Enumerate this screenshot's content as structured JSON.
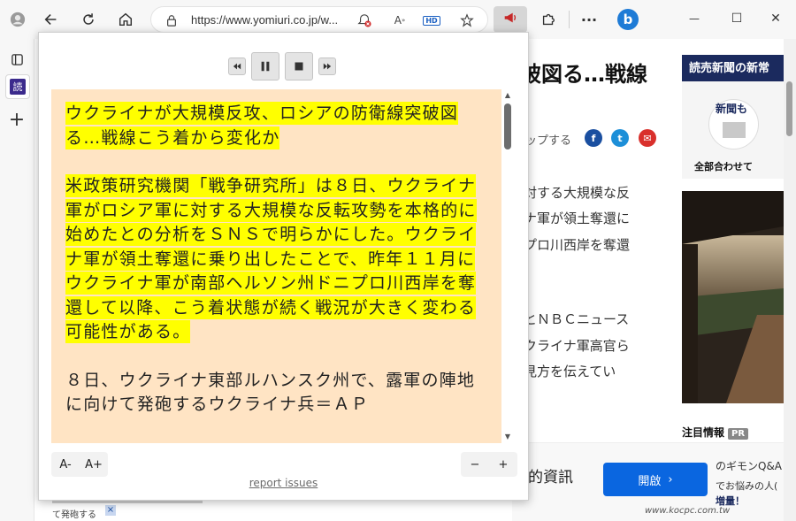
{
  "browser": {
    "url": "https://www.yomiuri.co.jp/w...",
    "hd_badge": "HD",
    "bing_letter": "b",
    "minimize": "—",
    "maximize": "☐",
    "close": "✕"
  },
  "sidebar": {
    "read_badge": "読"
  },
  "page": {
    "headline_fragment": "破図る…戦線",
    "share_text": "ップする",
    "social": [
      "f",
      "t",
      "✉"
    ],
    "body_lines": [
      "対する大規模な反",
      "ナ軍が領土奪還に",
      "プロ川西岸を奪還",
      "とＮＢＣニュース",
      "クライナ軍高官ら",
      "見方を伝えてい"
    ],
    "ad_title": "読売新聞の新常",
    "ad_sub": "新聞も",
    "ad_caption": "全部合わせて",
    "notice": "注目情報",
    "pr": "PR",
    "bottom_ad_text": "的資訊",
    "open_button": "開啟",
    "right_snips": [
      "のギモンQ&A",
      "でお悩みの人(",
      "増量！"
    ],
    "under_caption": "て発砲する",
    "watermark": "www.kocpc.com.tw"
  },
  "reader": {
    "title": "ウクライナが大規模反攻、ロシアの防衛線突破図る…戦線こう着から変化か",
    "para1": "米政策研究機関「戦争研究所」は８日、ウクライナ軍がロシア軍に対する大規模な反転攻勢を本格的に始めたとの分析をＳＮＳで明らかにした。ウクライナ軍が領土奪還に乗り出したことで、昨年１１月にウクライナ軍が南部ヘルソン州ドニプロ川西岸を奪還して以降、こう着状態が続く戦況が大きく変わる可能性がある。",
    "para2": "８日、ウクライナ東部ルハンスク州で、露軍の陣地に向けて発砲するウクライナ兵＝ＡＰ",
    "font_decrease": "A-",
    "font_increase": "A+",
    "rate_decrease": "−",
    "rate_increase": "+",
    "report_link": "report issues"
  },
  "colors": {
    "highlight": "#ffff00",
    "reader_bg": "#ffe4c4",
    "open_button": "#0a66e0",
    "ad_header": "#1b2a5e"
  }
}
